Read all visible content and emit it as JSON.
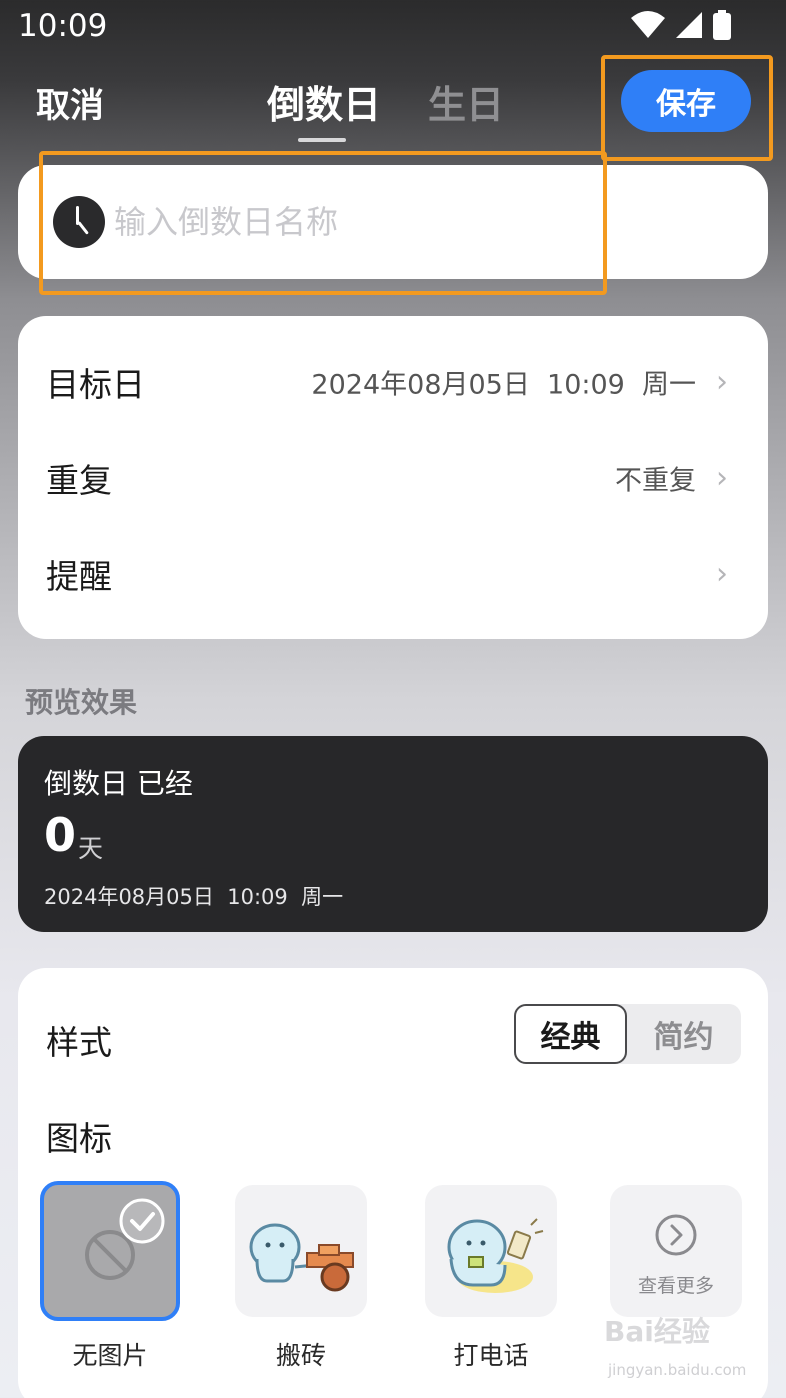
{
  "status_bar": {
    "time": "10:09"
  },
  "nav": {
    "cancel": "取消",
    "tabs": [
      {
        "label": "倒数日",
        "active": true
      },
      {
        "label": "生日",
        "active": false
      }
    ],
    "save": "保存"
  },
  "name": {
    "placeholder": "输入倒数日名称",
    "value": ""
  },
  "settings": [
    {
      "label": "目标日",
      "value": "2024年08月05日  10:09  周一"
    },
    {
      "label": "重复",
      "value": "不重复"
    },
    {
      "label": "提醒",
      "value": ""
    }
  ],
  "preview": {
    "section_title": "预览效果",
    "title": "倒数日 已经",
    "days": "0",
    "unit": "天",
    "date": "2024年08月05日  10:09  周一"
  },
  "style": {
    "label": "样式",
    "options": [
      "经典",
      "简约"
    ],
    "selected": "经典",
    "icon_label": "图标",
    "icons": [
      {
        "caption": "无图片",
        "icon": "no-image-icon",
        "selected": true
      },
      {
        "caption": "搬砖",
        "icon": "sticker-moving-bricks",
        "selected": false
      },
      {
        "caption": "打电话",
        "icon": "sticker-phone-call",
        "selected": false
      },
      {
        "caption": "",
        "more": "查看更多",
        "icon": "chevron-right-circle-icon",
        "selected": false
      }
    ]
  },
  "watermark": {
    "text": "Bai经验",
    "sub": "jingyan.baidu.com"
  },
  "colors": {
    "accent": "#2f7ff7",
    "highlight": "#f39a1f",
    "preview_bg": "#272729"
  }
}
